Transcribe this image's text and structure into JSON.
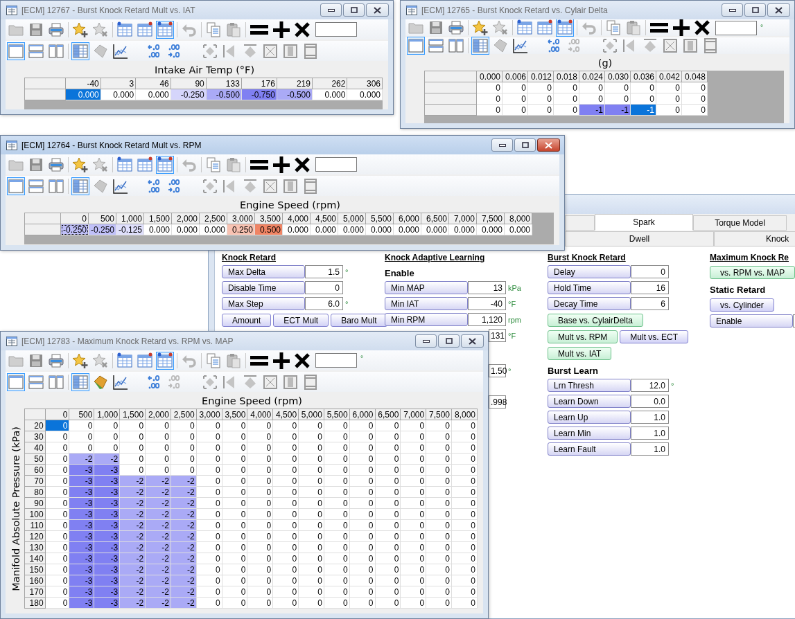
{
  "windows": [
    {
      "title": "[ECM] 12767 - Burst Knock Retard Mult vs. IAT",
      "active": false,
      "decimals_right_disabled": false,
      "surface_colored": false,
      "x_label": "Intake Air Temp (°F)",
      "columns": [
        "-40",
        "3",
        "46",
        "90",
        "133",
        "176",
        "219",
        "262",
        "306"
      ],
      "rows": [
        {
          "values": [
            "0.000",
            "0.000",
            "0.000",
            "-0.250",
            "-0.500",
            "-0.750",
            "-0.500",
            "0.000",
            "0.000"
          ],
          "selected": [
            true,
            false,
            false,
            false,
            false,
            false,
            false,
            false,
            false
          ]
        }
      ]
    },
    {
      "title": "[ECM] 12765 - Burst Knock Retard vs. Cylair Delta",
      "active": false,
      "field_unit": "°",
      "decimals_right_disabled": true,
      "surface_colored": false,
      "x_label": "(g)",
      "columns": [
        "0.000",
        "0.006",
        "0.012",
        "0.018",
        "0.024",
        "0.030",
        "0.036",
        "0.042",
        "0.048"
      ],
      "rows": [
        {
          "values": [
            "0",
            "0",
            "0",
            "0",
            "0",
            "0",
            "0",
            "0",
            "0"
          ],
          "selected": [
            false,
            false,
            false,
            false,
            false,
            false,
            false,
            false,
            false
          ]
        },
        {
          "values": [
            "0",
            "0",
            "0",
            "0",
            "0",
            "0",
            "0",
            "0",
            "0"
          ],
          "selected": [
            false,
            false,
            false,
            false,
            false,
            false,
            false,
            false,
            false
          ]
        },
        {
          "values": [
            "0",
            "0",
            "0",
            "0",
            "-1",
            "-1",
            "-1",
            "0",
            "0"
          ],
          "selected": [
            false,
            false,
            false,
            false,
            false,
            false,
            true,
            false,
            false
          ]
        }
      ]
    },
    {
      "title": "[ECM] 12764 - Burst Knock Retard Mult vs. RPM",
      "active": true,
      "decimals_right_disabled": false,
      "surface_colored": false,
      "x_label": "Engine Speed (rpm)",
      "columns": [
        "0",
        "500",
        "1,000",
        "1,500",
        "2,000",
        "2,500",
        "3,000",
        "3,500",
        "4,000",
        "4,500",
        "5,000",
        "5,500",
        "6,000",
        "6,500",
        "7,000",
        "7,500",
        "8,000"
      ],
      "rows": [
        {
          "values": [
            "-0.250",
            "-0.250",
            "-0.125",
            "0.000",
            "0.000",
            "0.000",
            "0.250",
            "0.500",
            "0.000",
            "0.000",
            "0.000",
            "0.000",
            "0.000",
            "0.000",
            "0.000",
            "0.000",
            "0.000"
          ],
          "selected": [
            true,
            false,
            false,
            false,
            false,
            false,
            false,
            false,
            false,
            false,
            false,
            false,
            false,
            false,
            false,
            false,
            false
          ]
        }
      ]
    },
    {
      "title": "[ECM] 12783 - Maximum Knock Retard vs. RPM vs. MAP",
      "active": false,
      "field_unit": "°",
      "decimals_right_disabled": true,
      "surface_colored": true,
      "x_label": "Engine Speed (rpm)",
      "y_label": "Manifold Absolute Pressure (kPa)",
      "columns": [
        "0",
        "500",
        "1,000",
        "1,500",
        "2,000",
        "2,500",
        "3,000",
        "3,500",
        "4,000",
        "4,500",
        "5,000",
        "5,500",
        "6,000",
        "6,500",
        "7,000",
        "7,500",
        "8,000"
      ],
      "rows": [
        {
          "label": "20",
          "values": [
            "0",
            "0",
            "0",
            "0",
            "0",
            "0",
            "0",
            "0",
            "0",
            "0",
            "0",
            "0",
            "0",
            "0",
            "0",
            "0",
            "0"
          ],
          "selected": [
            true,
            false,
            false,
            false,
            false,
            false,
            false,
            false,
            false,
            false,
            false,
            false,
            false,
            false,
            false,
            false,
            false
          ]
        },
        {
          "label": "30",
          "values": [
            "0",
            "0",
            "0",
            "0",
            "0",
            "0",
            "0",
            "0",
            "0",
            "0",
            "0",
            "0",
            "0",
            "0",
            "0",
            "0",
            "0"
          ],
          "selected": [
            false,
            false,
            false,
            false,
            false,
            false,
            false,
            false,
            false,
            false,
            false,
            false,
            false,
            false,
            false,
            false,
            false
          ]
        },
        {
          "label": "40",
          "values": [
            "0",
            "0",
            "0",
            "0",
            "0",
            "0",
            "0",
            "0",
            "0",
            "0",
            "0",
            "0",
            "0",
            "0",
            "0",
            "0",
            "0"
          ],
          "selected": [
            false,
            false,
            false,
            false,
            false,
            false,
            false,
            false,
            false,
            false,
            false,
            false,
            false,
            false,
            false,
            false,
            false
          ]
        },
        {
          "label": "50",
          "values": [
            "0",
            "-2",
            "-2",
            "0",
            "0",
            "0",
            "0",
            "0",
            "0",
            "0",
            "0",
            "0",
            "0",
            "0",
            "0",
            "0",
            "0"
          ],
          "selected": [
            false,
            false,
            false,
            false,
            false,
            false,
            false,
            false,
            false,
            false,
            false,
            false,
            false,
            false,
            false,
            false,
            false
          ]
        },
        {
          "label": "60",
          "values": [
            "0",
            "-3",
            "-3",
            "0",
            "0",
            "0",
            "0",
            "0",
            "0",
            "0",
            "0",
            "0",
            "0",
            "0",
            "0",
            "0",
            "0"
          ],
          "selected": [
            false,
            false,
            false,
            false,
            false,
            false,
            false,
            false,
            false,
            false,
            false,
            false,
            false,
            false,
            false,
            false,
            false
          ]
        },
        {
          "label": "70",
          "values": [
            "0",
            "-3",
            "-3",
            "-2",
            "-2",
            "-2",
            "0",
            "0",
            "0",
            "0",
            "0",
            "0",
            "0",
            "0",
            "0",
            "0",
            "0"
          ],
          "selected": [
            false,
            false,
            false,
            false,
            false,
            false,
            false,
            false,
            false,
            false,
            false,
            false,
            false,
            false,
            false,
            false,
            false
          ]
        },
        {
          "label": "80",
          "values": [
            "0",
            "-3",
            "-3",
            "-2",
            "-2",
            "-2",
            "0",
            "0",
            "0",
            "0",
            "0",
            "0",
            "0",
            "0",
            "0",
            "0",
            "0"
          ],
          "selected": [
            false,
            false,
            false,
            false,
            false,
            false,
            false,
            false,
            false,
            false,
            false,
            false,
            false,
            false,
            false,
            false,
            false
          ]
        },
        {
          "label": "90",
          "values": [
            "0",
            "-3",
            "-3",
            "-2",
            "-2",
            "-2",
            "0",
            "0",
            "0",
            "0",
            "0",
            "0",
            "0",
            "0",
            "0",
            "0",
            "0"
          ],
          "selected": [
            false,
            false,
            false,
            false,
            false,
            false,
            false,
            false,
            false,
            false,
            false,
            false,
            false,
            false,
            false,
            false,
            false
          ]
        },
        {
          "label": "100",
          "values": [
            "0",
            "-3",
            "-3",
            "-2",
            "-2",
            "-2",
            "0",
            "0",
            "0",
            "0",
            "0",
            "0",
            "0",
            "0",
            "0",
            "0",
            "0"
          ],
          "selected": [
            false,
            false,
            false,
            false,
            false,
            false,
            false,
            false,
            false,
            false,
            false,
            false,
            false,
            false,
            false,
            false,
            false
          ]
        },
        {
          "label": "110",
          "values": [
            "0",
            "-3",
            "-3",
            "-2",
            "-2",
            "-2",
            "0",
            "0",
            "0",
            "0",
            "0",
            "0",
            "0",
            "0",
            "0",
            "0",
            "0"
          ],
          "selected": [
            false,
            false,
            false,
            false,
            false,
            false,
            false,
            false,
            false,
            false,
            false,
            false,
            false,
            false,
            false,
            false,
            false
          ]
        },
        {
          "label": "120",
          "values": [
            "0",
            "-3",
            "-3",
            "-2",
            "-2",
            "-2",
            "0",
            "0",
            "0",
            "0",
            "0",
            "0",
            "0",
            "0",
            "0",
            "0",
            "0"
          ],
          "selected": [
            false,
            false,
            false,
            false,
            false,
            false,
            false,
            false,
            false,
            false,
            false,
            false,
            false,
            false,
            false,
            false,
            false
          ]
        },
        {
          "label": "130",
          "values": [
            "0",
            "-3",
            "-3",
            "-2",
            "-2",
            "-2",
            "0",
            "0",
            "0",
            "0",
            "0",
            "0",
            "0",
            "0",
            "0",
            "0",
            "0"
          ],
          "selected": [
            false,
            false,
            false,
            false,
            false,
            false,
            false,
            false,
            false,
            false,
            false,
            false,
            false,
            false,
            false,
            false,
            false
          ]
        },
        {
          "label": "140",
          "values": [
            "0",
            "-3",
            "-3",
            "-2",
            "-2",
            "-2",
            "0",
            "0",
            "0",
            "0",
            "0",
            "0",
            "0",
            "0",
            "0",
            "0",
            "0"
          ],
          "selected": [
            false,
            false,
            false,
            false,
            false,
            false,
            false,
            false,
            false,
            false,
            false,
            false,
            false,
            false,
            false,
            false,
            false
          ]
        },
        {
          "label": "150",
          "values": [
            "0",
            "-3",
            "-3",
            "-2",
            "-2",
            "-2",
            "0",
            "0",
            "0",
            "0",
            "0",
            "0",
            "0",
            "0",
            "0",
            "0",
            "0"
          ],
          "selected": [
            false,
            false,
            false,
            false,
            false,
            false,
            false,
            false,
            false,
            false,
            false,
            false,
            false,
            false,
            false,
            false,
            false
          ]
        },
        {
          "label": "160",
          "values": [
            "0",
            "-3",
            "-3",
            "-2",
            "-2",
            "-2",
            "0",
            "0",
            "0",
            "0",
            "0",
            "0",
            "0",
            "0",
            "0",
            "0",
            "0"
          ],
          "selected": [
            false,
            false,
            false,
            false,
            false,
            false,
            false,
            false,
            false,
            false,
            false,
            false,
            false,
            false,
            false,
            false,
            false
          ]
        },
        {
          "label": "170",
          "values": [
            "0",
            "-3",
            "-3",
            "-2",
            "-2",
            "-2",
            "0",
            "0",
            "0",
            "0",
            "0",
            "0",
            "0",
            "0",
            "0",
            "0",
            "0"
          ],
          "selected": [
            false,
            false,
            false,
            false,
            false,
            false,
            false,
            false,
            false,
            false,
            false,
            false,
            false,
            false,
            false,
            false,
            false
          ]
        },
        {
          "label": "180",
          "values": [
            "0",
            "-3",
            "-3",
            "-2",
            "-2",
            "-2",
            "0",
            "0",
            "0",
            "0",
            "0",
            "0",
            "0",
            "0",
            "0",
            "0",
            "0"
          ],
          "selected": [
            false,
            false,
            false,
            false,
            false,
            false,
            false,
            false,
            false,
            false,
            false,
            false,
            false,
            false,
            false,
            false,
            false
          ]
        }
      ]
    }
  ],
  "main_window": {
    "tabs": [
      [
        {
          "label": "Spark",
          "selected": true
        },
        {
          "label": "Torque Model",
          "selected": false
        }
      ],
      [
        {
          "label": "Dwell",
          "selected": false
        },
        {
          "label": "Knock",
          "selected": false
        }
      ]
    ],
    "sections": [
      {
        "title": "Knock Retard",
        "items": [
          {
            "kind": "field",
            "label": "Max Delta",
            "value": "1.5",
            "unit": "°"
          },
          {
            "kind": "field",
            "label": "Disable Time",
            "value": "0"
          },
          {
            "kind": "field",
            "label": "Max Step",
            "value": "6.0",
            "unit": "°"
          },
          {
            "kind": "buttons",
            "buttons": [
              {
                "label": "Amount",
                "highlighted": false
              },
              {
                "label": "ECT Mult",
                "highlighted": false
              },
              {
                "label": "Baro Mult",
                "highlighted": false
              }
            ]
          }
        ]
      },
      {
        "title": "Knock Adaptive Learning",
        "items": [
          {
            "kind": "subheading",
            "text": "Enable"
          },
          {
            "kind": "field",
            "label": "Min MAP",
            "value": "13",
            "unit": "kPa"
          },
          {
            "kind": "field",
            "label": "Min IAT",
            "value": "-40",
            "unit": "°F"
          },
          {
            "kind": "field",
            "label": "Min RPM",
            "value": "1,120",
            "unit": "rpm"
          },
          {
            "kind": "field",
            "value": "131",
            "unit": "°F"
          },
          {
            "kind": "field",
            "value": "1.50",
            "unit": "°"
          },
          {
            "kind": "field",
            "value": ".998"
          }
        ]
      },
      {
        "title": "Burst Knock Retard",
        "items": [
          {
            "kind": "field",
            "label": "Delay",
            "value": "0"
          },
          {
            "kind": "field",
            "label": "Hold Time",
            "value": "16"
          },
          {
            "kind": "field",
            "label": "Decay Time",
            "value": "6"
          },
          {
            "kind": "buttons",
            "buttons": [
              {
                "label": "Base vs. CylairDelta",
                "highlighted": true
              }
            ]
          },
          {
            "kind": "buttons",
            "buttons": [
              {
                "label": "Mult vs. RPM",
                "highlighted": true
              },
              {
                "label": "Mult vs. ECT",
                "highlighted": false
              }
            ]
          },
          {
            "kind": "buttons",
            "buttons": [
              {
                "label": "Mult vs. IAT",
                "highlighted": true
              }
            ]
          },
          {
            "kind": "subheading",
            "text": "Burst Learn"
          },
          {
            "kind": "field",
            "label": "Lrn Thresh",
            "value": "12.0",
            "unit": "°"
          },
          {
            "kind": "field",
            "label": "Learn Down",
            "value": "0.0"
          },
          {
            "kind": "field",
            "label": "Learn Up",
            "value": "1.0"
          },
          {
            "kind": "field",
            "label": "Learn Min",
            "value": "1.0"
          },
          {
            "kind": "field",
            "label": "Learn Fault",
            "value": "1.0"
          }
        ]
      },
      {
        "title": "Maximum Knock Re",
        "items": [
          {
            "kind": "buttons",
            "buttons": [
              {
                "label": "vs. RPM vs. MAP",
                "highlighted": true
              }
            ]
          },
          {
            "kind": "subheading",
            "text": "Static Retard"
          },
          {
            "kind": "buttons",
            "buttons": [
              {
                "label": "vs. Cylinder",
                "highlighted": false
              }
            ]
          },
          {
            "kind": "field",
            "label": "Enable"
          }
        ]
      }
    ]
  }
}
